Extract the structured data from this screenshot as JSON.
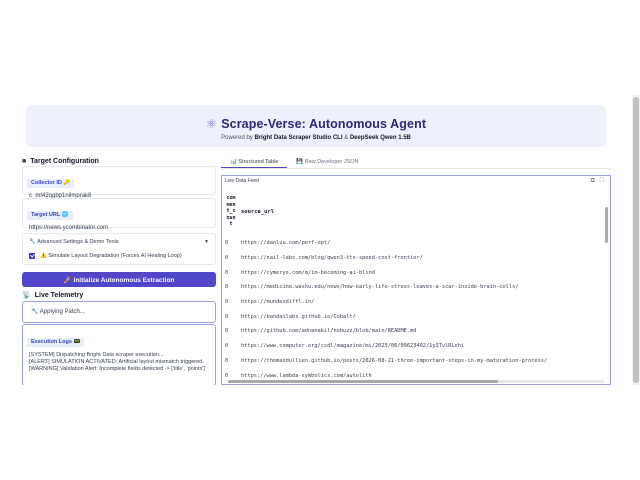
{
  "header": {
    "title": "Scrape-Verse: Autonomous Agent",
    "subtitle_prefix": "Powered by ",
    "subtitle_brand1": "Bright Data Scraper Studio CLI",
    "subtitle_amp": " & ",
    "subtitle_brand2": "DeepSeek Qwen 1.5B"
  },
  "config": {
    "section_title": "Target Configuration",
    "collector_label": "Collector ID 🔑",
    "collector_value": "c_mt42qgbp1nilmprak8",
    "url_label": "Target URL 🌐",
    "url_value": "https://news.ycombinator.com",
    "advanced_label": "🔧 Advanced Settings & Demo Tools",
    "simulate_label": "⚠️ Simulate Layout Degradation (Forces AI Healing Loop)",
    "simulate_checked": true,
    "start_button": "🚀 Initialize Autonomous Extraction"
  },
  "telemetry": {
    "section_title": "Live Telemetry",
    "status_text": "🔧 Applying Patch...",
    "logs_label": "Execution Logs 📟",
    "logs": [
      "[SYSTEM] Dispatching Bright Data scraper execution...",
      "[ALERT] SIMULATION ACTIVATED: Artificial layout mismatch triggered.",
      "[WARNING] Validation Alert: Incomplete fields detected -> ['title', 'points']"
    ]
  },
  "results": {
    "tabs": [
      {
        "label": "📊 Structured Table",
        "active": true
      },
      {
        "label": "💾 Raw Developer JSON",
        "active": false
      }
    ],
    "feed_label": "Live Data Feed",
    "columns": {
      "count": "comment_count",
      "url": "source_url"
    },
    "rows": [
      {
        "count": "0",
        "url": "https://danluu.com/perf-opt/"
      },
      {
        "count": "0",
        "url": "https://nail-labs.com/blog/qwen3-tts-speed-cost-frontier/"
      },
      {
        "count": "0",
        "url": "https://cymerys.com/m/im-becoming-ai-blind"
      },
      {
        "count": "0",
        "url": "https://medicine.washu.edu/news/how-early-life-stress-leaves-a-scar-inside-brain-cells/"
      },
      {
        "count": "0",
        "url": "https://mundezdiffl.in/"
      },
      {
        "count": "0",
        "url": "https://bandailabs.github.io/Cobalt/"
      },
      {
        "count": "0",
        "url": "https://github.com/adnanakil/nobuzz/blob/main/README.md"
      },
      {
        "count": "0",
        "url": "https://www.computer.org/csdl/magazine/mi/2025/06/09623402/1y3TvlRLehi"
      },
      {
        "count": "0",
        "url": "https://thomasdullien.github.io/posts/2026-08-21-three-important-steps-in-my-maturation-process/"
      },
      {
        "count": "0",
        "url": "https://www.lambda-symbolics.com/autolith"
      }
    ]
  }
}
